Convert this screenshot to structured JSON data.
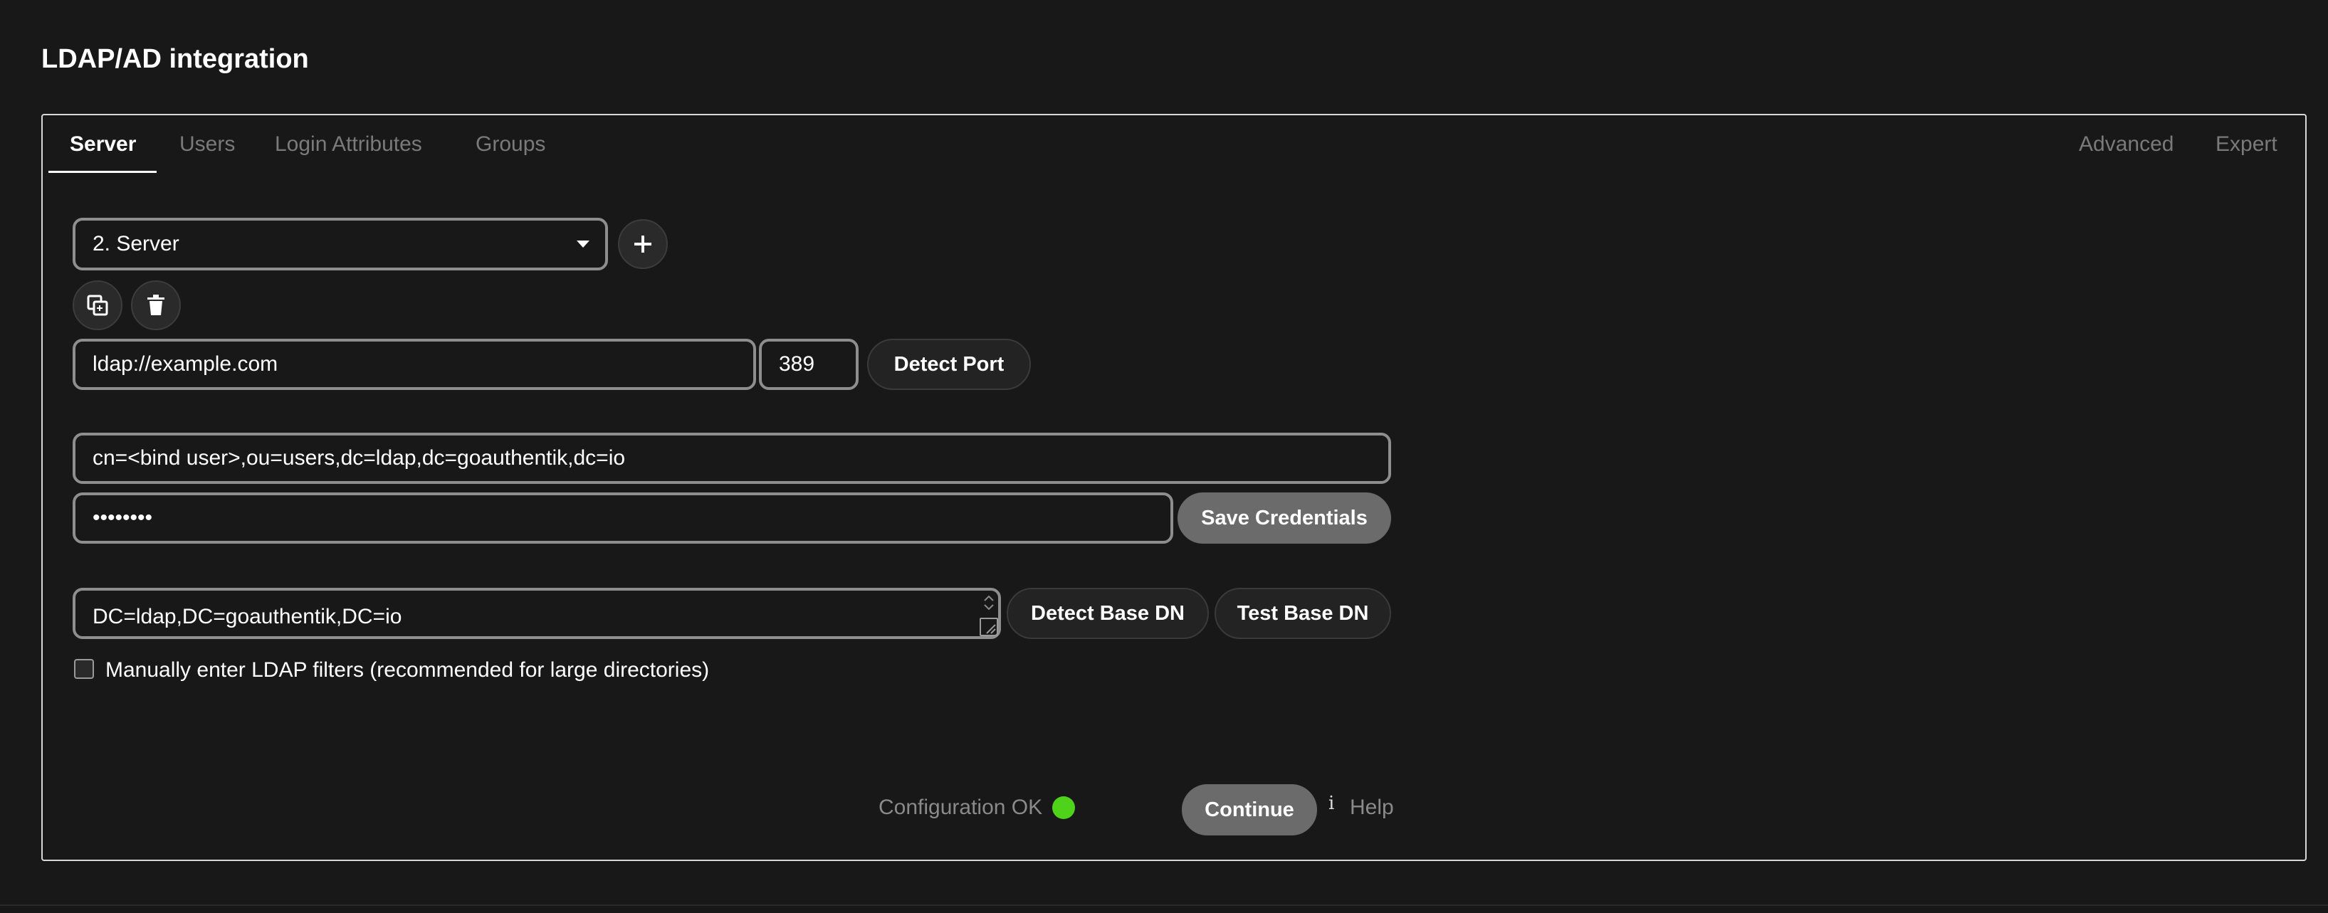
{
  "page": {
    "title": "LDAP/AD integration"
  },
  "tabs": [
    {
      "label": "Server"
    },
    {
      "label": "Users"
    },
    {
      "label": "Login Attributes"
    },
    {
      "label": "Groups"
    },
    {
      "label": "Advanced"
    },
    {
      "label": "Expert"
    }
  ],
  "server": {
    "config_select": {
      "selected": "2. Server"
    },
    "host": {
      "value": "ldap://example.com"
    },
    "port": {
      "value": "389"
    },
    "detect_port_label": "Detect Port",
    "bind_dn": {
      "value": "cn=<bind user>,ou=users,dc=ldap,dc=goauthentik,dc=io"
    },
    "password": {
      "value": "••••••••"
    },
    "save_credentials_label": "Save Credentials",
    "base_dn": {
      "value": "DC=ldap,DC=goauthentik,DC=io"
    },
    "detect_base_dn_label": "Detect Base DN",
    "test_base_dn_label": "Test Base DN",
    "manual_filters_label": "Manually enter LDAP filters (recommended for large directories)"
  },
  "footer": {
    "status_text": "Configuration OK",
    "status_color": "#4fd21a",
    "continue_label": "Continue",
    "help_label": "Help"
  }
}
